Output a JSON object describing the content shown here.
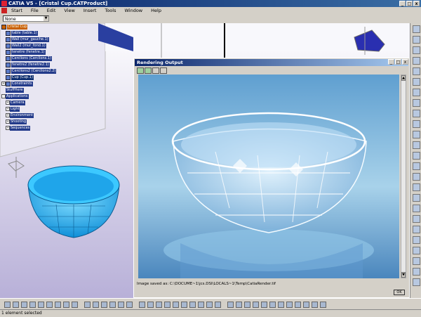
{
  "window": {
    "title": "CATIA V5 - [Cristal Cup.CATProduct]",
    "controls": [
      "_",
      "□",
      "x"
    ]
  },
  "menu": [
    "Start",
    "File",
    "Edit",
    "View",
    "Insert",
    "Tools",
    "Window",
    "Help"
  ],
  "filter": {
    "value": "None"
  },
  "tree": {
    "root": "Cristal Cup",
    "items": [
      "table (table.1)",
      "Wall (mur_gauche.1)",
      "Wall2 (mur_fond.1)",
      "tenetre (fenetre.1)",
      "Cerclions (Cerclions.1)",
      "fenetre2 (fenetre2.1)",
      "Cerclions2 (Cerclions2.2)",
      "Cup (Cup.1)"
    ],
    "constraints": "Constraints",
    "extra": "StuffHere",
    "applications": "Applications",
    "app_children": [
      "Camera",
      "Light",
      "Environment",
      "Shooting",
      "Sequences"
    ]
  },
  "render_window": {
    "title": "Rendering Output",
    "saved_text": "Image saved as: C:\\DOCUME~1\\jcs.DSI\\LOCALS~1\\Temp\\CatiaRender.tif",
    "ok_label": "OK"
  },
  "status": {
    "text": "1 element selected"
  },
  "colors": {
    "cup_blue": "#1fa5ea",
    "tree_bg": "#223a8a",
    "root_orange": "#c86000"
  }
}
